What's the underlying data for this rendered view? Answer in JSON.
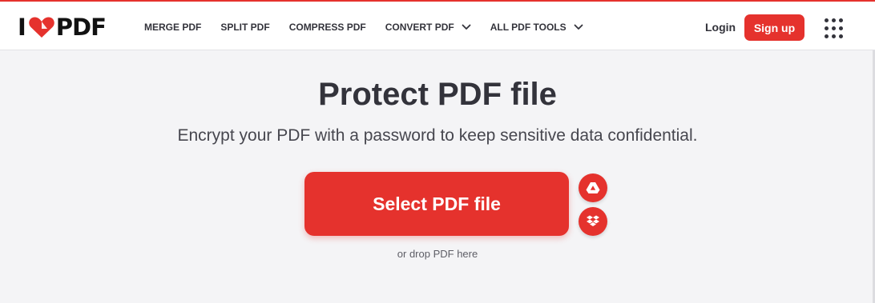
{
  "brand": {
    "logo_left": "I",
    "logo_right": "PDF",
    "accent_color": "#e5322d"
  },
  "nav": {
    "items": [
      {
        "label": "MERGE PDF",
        "dropdown": false
      },
      {
        "label": "SPLIT PDF",
        "dropdown": false
      },
      {
        "label": "COMPRESS PDF",
        "dropdown": false
      },
      {
        "label": "CONVERT PDF",
        "dropdown": true
      },
      {
        "label": "ALL PDF TOOLS",
        "dropdown": true
      }
    ]
  },
  "account": {
    "login_label": "Login",
    "signup_label": "Sign up"
  },
  "main": {
    "title": "Protect PDF file",
    "subtitle": "Encrypt your PDF with a password to keep sensitive data confidential.",
    "select_button_label": "Select PDF file",
    "drop_text": "or drop PDF here",
    "cloud_buttons": [
      "google-drive-icon",
      "dropbox-icon"
    ]
  },
  "icons": {
    "logo_heart": "heart-icon",
    "apps_menu": "grid-menu-icon",
    "dropdown": "chevron-down-icon"
  }
}
